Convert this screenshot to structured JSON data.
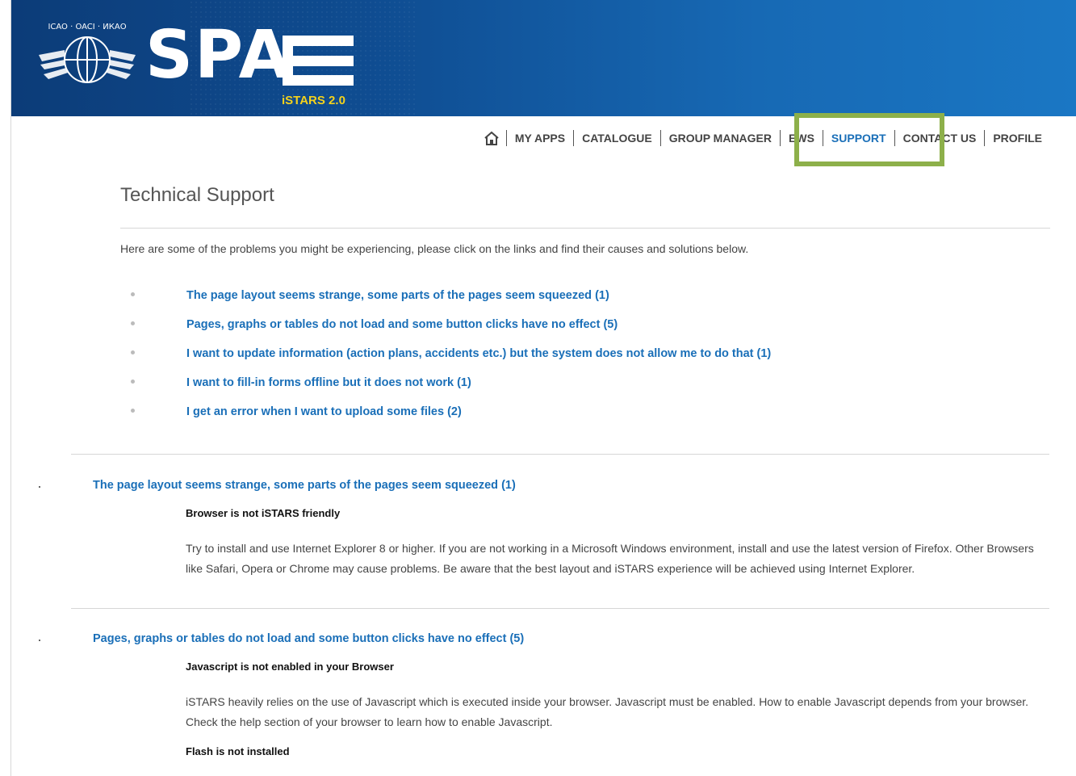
{
  "brand": {
    "logo_text": "SPA",
    "logo_subtitle": "iSTARS 2.0",
    "emblem_text": "ICAO · OACI · ИКАО"
  },
  "nav": {
    "home_icon": "home-icon",
    "items": [
      "MY APPS",
      "CATALOGUE",
      "GROUP MANAGER",
      "EWS",
      "SUPPORT",
      "CONTACT US",
      "PROFILE"
    ],
    "active": "SUPPORT"
  },
  "page": {
    "title": "Technical Support",
    "intro": "Here are some of the problems you might be experiencing, please click on the links and find their causes and solutions below."
  },
  "problems": [
    "The page layout seems strange, some parts of the pages seem squeezed (1)",
    "Pages, graphs or tables do not load and some button clicks have no effect (5)",
    "I want to update information (action plans, accidents etc.) but the system does not allow me to do that (1)",
    "I want to fill-in forms offline but it does not work (1)",
    "I get an error when I want to upload some files (2)"
  ],
  "sections": [
    {
      "title": "The page layout seems strange, some parts of the pages seem squeezed (1)",
      "causes": [
        {
          "title": "Browser is not iSTARS friendly",
          "text": "Try to install and use Internet Explorer 8 or higher. If you are not working in a Microsoft Windows environment, install and use the latest version of Firefox. Other Browsers like Safari, Opera or Chrome may cause problems. Be aware that the best layout and iSTARS experience will be achieved using Internet Explorer."
        }
      ]
    },
    {
      "title": "Pages, graphs or tables do not load and some button clicks have no effect (5)",
      "causes": [
        {
          "title": "Javascript is not enabled in your Browser",
          "text": "iSTARS heavily relies on the use of Javascript which is executed inside your browser. Javascript must be enabled. How to enable Javascript depends from your browser. Check the help section of your browser to learn how to enable Javascript."
        },
        {
          "title": "Flash is not installed",
          "text": ""
        }
      ]
    }
  ],
  "colors": {
    "link": "#1a6fb8",
    "highlight": "#8db04a",
    "banner_dark": "#0c3c78",
    "banner_light": "#1a77c4",
    "subtitle": "#f4d21c"
  }
}
